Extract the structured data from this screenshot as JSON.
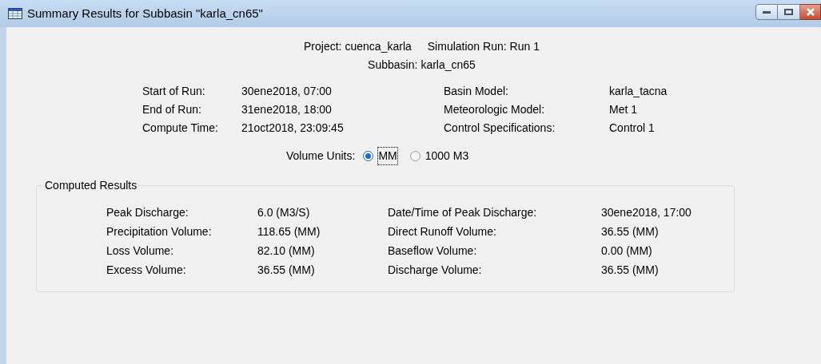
{
  "window": {
    "title": "Summary Results for Subbasin \"karla_cn65\""
  },
  "header": {
    "line_1": [
      {
        "label": "Project:",
        "value": "cuenca_karla"
      },
      {
        "label": "Simulation Run:",
        "value": "Run 1"
      }
    ],
    "line_2": [
      {
        "label": "Subbasin:",
        "value": "karla_cn65"
      }
    ]
  },
  "run_info": [
    {
      "label": "Start of Run:",
      "value": "30ene2018, 07:00",
      "label_2": "Basin Model:",
      "value_2": "karla_tacna"
    },
    {
      "label": "End of Run:",
      "value": "31ene2018, 18:00",
      "label_2": "Meteorologic Model:",
      "value_2": "Met 1"
    },
    {
      "label": "Compute Time:",
      "value": "21oct2018, 23:09:45",
      "label_2": "Control Specifications:",
      "value_2": "Control 1"
    }
  ],
  "volume_units": {
    "label": "Volume Units:",
    "options": [
      {
        "label": "MM",
        "selected": true
      },
      {
        "label": "1000 M3",
        "selected": false
      }
    ]
  },
  "computed_results": {
    "title": "Computed Results",
    "rows": [
      {
        "label": "Peak Discharge:",
        "value": "6.0 (M3/S)",
        "label_2": "Date/Time of Peak Discharge:",
        "value_2": "30ene2018, 17:00"
      },
      {
        "label": "Precipitation Volume:",
        "value": "118.65 (MM)",
        "label_2": "Direct Runoff Volume:",
        "value_2": "36.55 (MM)"
      },
      {
        "label": "Loss Volume:",
        "value": "82.10 (MM)",
        "label_2": "Baseflow Volume:",
        "value_2": "0.00 (MM)"
      },
      {
        "label": "Excess Volume:",
        "value": "36.55 (MM)",
        "label_2": "Discharge Volume:",
        "value_2": "36.55 (MM)"
      }
    ]
  }
}
